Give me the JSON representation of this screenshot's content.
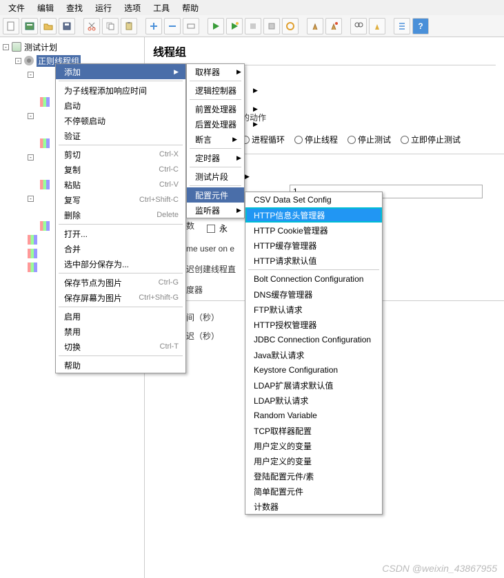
{
  "menubar": [
    "文件",
    "编辑",
    "查找",
    "运行",
    "选项",
    "工具",
    "帮助"
  ],
  "tree": {
    "root": "测试计划",
    "thread_group": "正则线程组"
  },
  "content": {
    "title": "线程组",
    "action_label_frag": "的动作",
    "radios": [
      "进程循环",
      "停止线程",
      "停止测试",
      "立即停止测试"
    ],
    "input_val": "1",
    "chk_label": "永",
    "frag1": "数",
    "frag2": "me user on e",
    "frag3": "迟创建线程直",
    "frag4": "度器",
    "frag5": "间（秒）",
    "frag6": "迟（秒）"
  },
  "context_menu1": [
    {
      "label": "添加",
      "hl": true,
      "arrow": true
    },
    {
      "sep": true
    },
    {
      "label": "为子线程添加响应时间"
    },
    {
      "label": "启动"
    },
    {
      "label": "不停顿启动"
    },
    {
      "label": "验证"
    },
    {
      "sep": true
    },
    {
      "label": "剪切",
      "sc": "Ctrl-X"
    },
    {
      "label": "复制",
      "sc": "Ctrl-C"
    },
    {
      "label": "粘贴",
      "sc": "Ctrl-V"
    },
    {
      "label": "复写",
      "sc": "Ctrl+Shift-C"
    },
    {
      "label": "删除",
      "sc": "Delete"
    },
    {
      "sep": true
    },
    {
      "label": "打开..."
    },
    {
      "label": "合并"
    },
    {
      "label": "选中部分保存为..."
    },
    {
      "sep": true
    },
    {
      "label": "保存节点为图片",
      "sc": "Ctrl-G"
    },
    {
      "label": "保存屏幕为图片",
      "sc": "Ctrl+Shift-G"
    },
    {
      "sep": true
    },
    {
      "label": "启用"
    },
    {
      "label": "禁用"
    },
    {
      "label": "切换",
      "sc": "Ctrl-T"
    },
    {
      "sep": true
    },
    {
      "label": "帮助"
    }
  ],
  "context_menu2": [
    {
      "label": "取样器",
      "arrow": true
    },
    {
      "sep": true
    },
    {
      "label": "逻辑控制器",
      "arrow": true
    },
    {
      "sep": true
    },
    {
      "label": "前置处理器",
      "arrow": true
    },
    {
      "label": "后置处理器",
      "arrow": true
    },
    {
      "label": "断言",
      "arrow": true
    },
    {
      "sep": true
    },
    {
      "label": "定时器",
      "arrow": true
    },
    {
      "sep": true
    },
    {
      "label": "测试片段",
      "arrow": true
    },
    {
      "sep": true
    },
    {
      "label": "配置元件",
      "hl": true,
      "arrow": true
    },
    {
      "label": "监听器",
      "arrow": true
    }
  ],
  "context_menu3": [
    {
      "label": "CSV Data Set Config"
    },
    {
      "label": "HTTP信息头管理器",
      "hl2": true
    },
    {
      "label": "HTTP Cookie管理器"
    },
    {
      "label": "HTTP缓存管理器"
    },
    {
      "label": "HTTP请求默认值"
    },
    {
      "sep": true
    },
    {
      "label": "Bolt Connection Configuration"
    },
    {
      "label": "DNS缓存管理器"
    },
    {
      "label": "FTP默认请求"
    },
    {
      "label": "HTTP授权管理器"
    },
    {
      "label": "JDBC Connection Configuration"
    },
    {
      "label": "Java默认请求"
    },
    {
      "label": "Keystore Configuration"
    },
    {
      "label": "LDAP扩展请求默认值"
    },
    {
      "label": "LDAP默认请求"
    },
    {
      "label": "Random Variable"
    },
    {
      "label": "TCP取样器配置"
    },
    {
      "label": "用户定义的变量"
    },
    {
      "label": "用户定义的变量"
    },
    {
      "label": "登陆配置元件/素"
    },
    {
      "label": "简单配置元件"
    },
    {
      "label": "计数器"
    }
  ],
  "watermark": "CSDN @weixin_43867955",
  "icons": {
    "new": "#fff",
    "open": "#e8c060",
    "save": "#d0b050",
    "disk": "#888",
    "cut": "#e07030",
    "copy": "#ccc",
    "paste": "#e0d080",
    "plus": "#4a90d9",
    "minus": "#4a90d9",
    "play": "#3a9d3a",
    "playplus": "#3a9d3a",
    "stop": "#999",
    "stop2": "#999",
    "clear": "#e0a030",
    "broom": "#d0a050",
    "broom2": "#d0a050",
    "binoc": "#555",
    "fn": "#e0b040",
    "list": "#4a90d9",
    "help": "#4a90d9"
  }
}
